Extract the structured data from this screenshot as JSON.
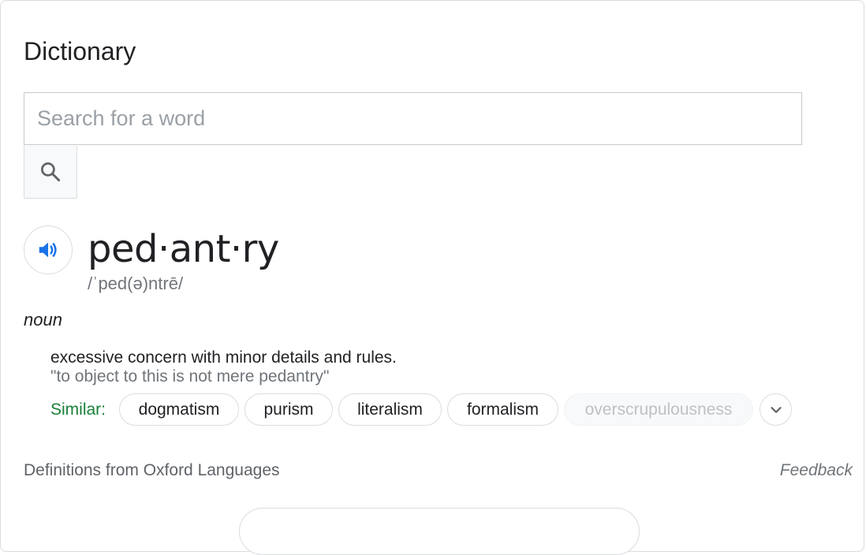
{
  "card": {
    "title": "Dictionary"
  },
  "search": {
    "placeholder": "Search for a word",
    "value": "",
    "button_icon": "search-icon"
  },
  "entry": {
    "speaker_icon": "speaker-icon",
    "headword": "ped·ant·ry",
    "phonetic": "/ˈped(ə)ntrē/",
    "part_of_speech": "noun",
    "definition": "excessive concern with minor details and rules.",
    "example": "\"to object to this is not mere pedantry\"",
    "similar_label": "Similar:",
    "similar": [
      "dogmatism",
      "purism",
      "literalism",
      "formalism",
      "overscrupulousness"
    ],
    "expand_icon": "chevron-down-icon"
  },
  "footer": {
    "source": "Definitions from Oxford Languages",
    "feedback": "Feedback"
  },
  "colors": {
    "accent_blue": "#1a73e8",
    "similar_green": "#188038",
    "secondary_text": "#70757a",
    "border": "#dadce0"
  }
}
